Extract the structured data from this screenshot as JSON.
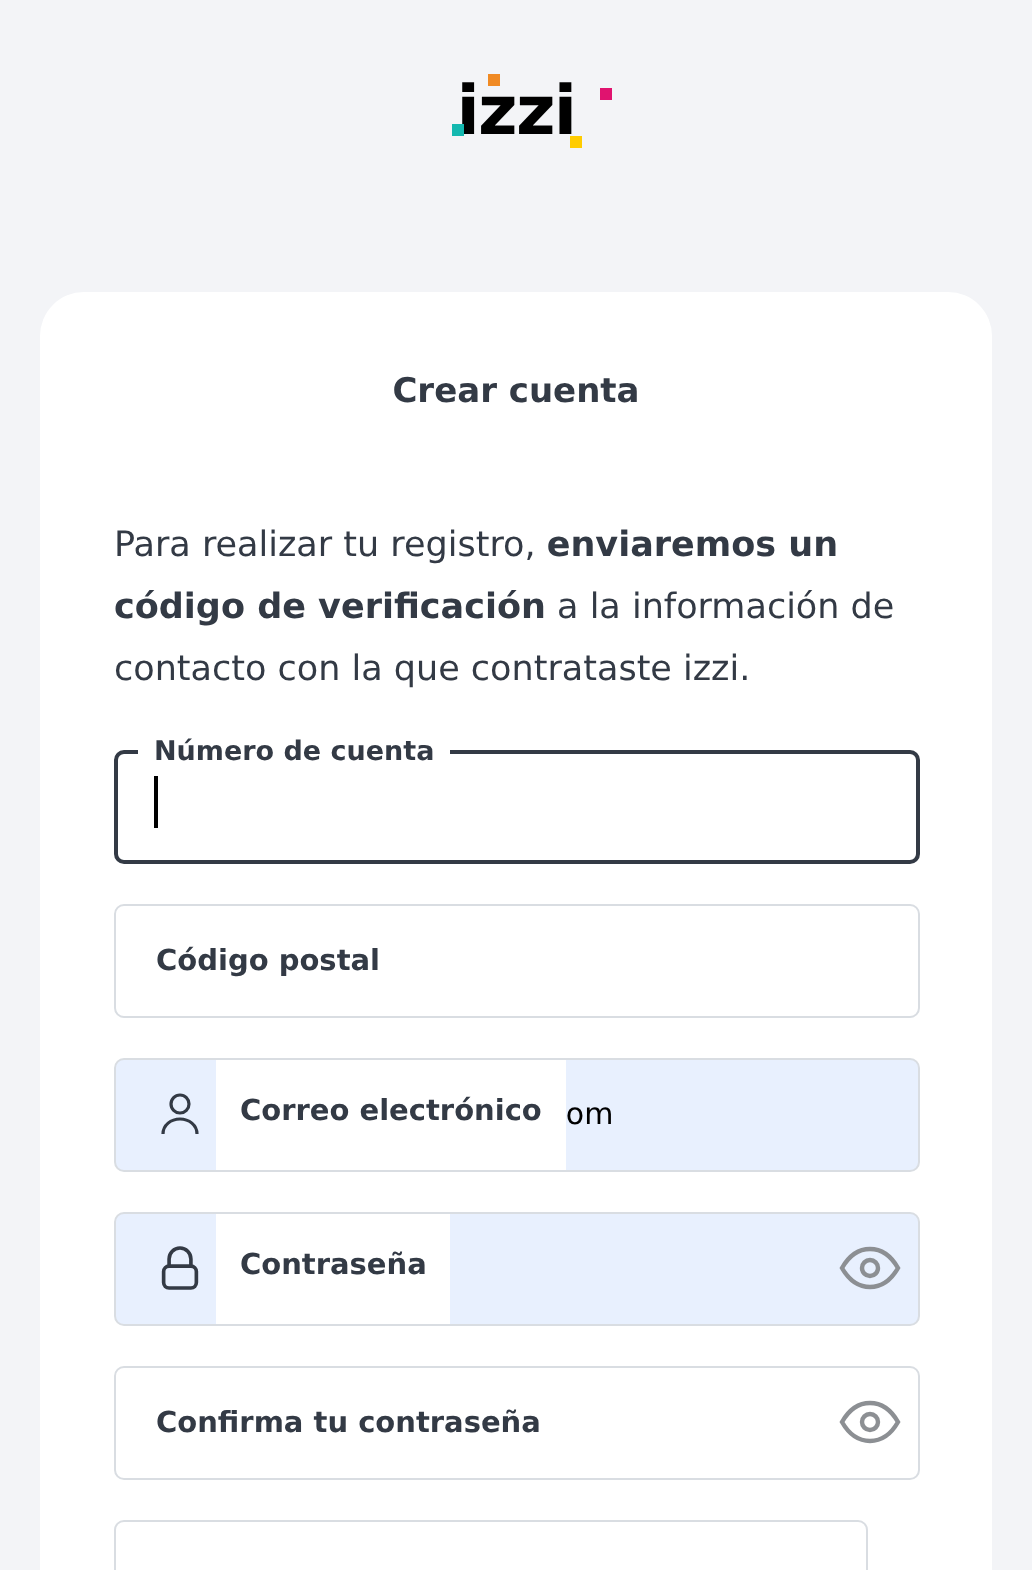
{
  "logo": {
    "text": "izzi"
  },
  "title": "Crear cuenta",
  "intro": "Para realizar tu registro, **enviaremos un código de verificación** a la información de contacto con la que contrataste izzi.",
  "fields": [
    {
      "label": "Número de cuenta",
      "focused": true,
      "autofilled": false
    },
    {
      "label": "Código postal",
      "focused": false,
      "autofilled": false
    },
    {
      "label": "Correo electrónico",
      "focused": false,
      "autofilled": true,
      "kind": "user",
      "value": "om"
    },
    {
      "label": "Contraseña",
      "focused": false,
      "autofilled": true,
      "kind": "lock",
      "reveal_toggle": true
    },
    {
      "label": "Confirma tu contraseña",
      "focused": false,
      "autofilled": false,
      "reveal_toggle": true
    }
  ]
}
